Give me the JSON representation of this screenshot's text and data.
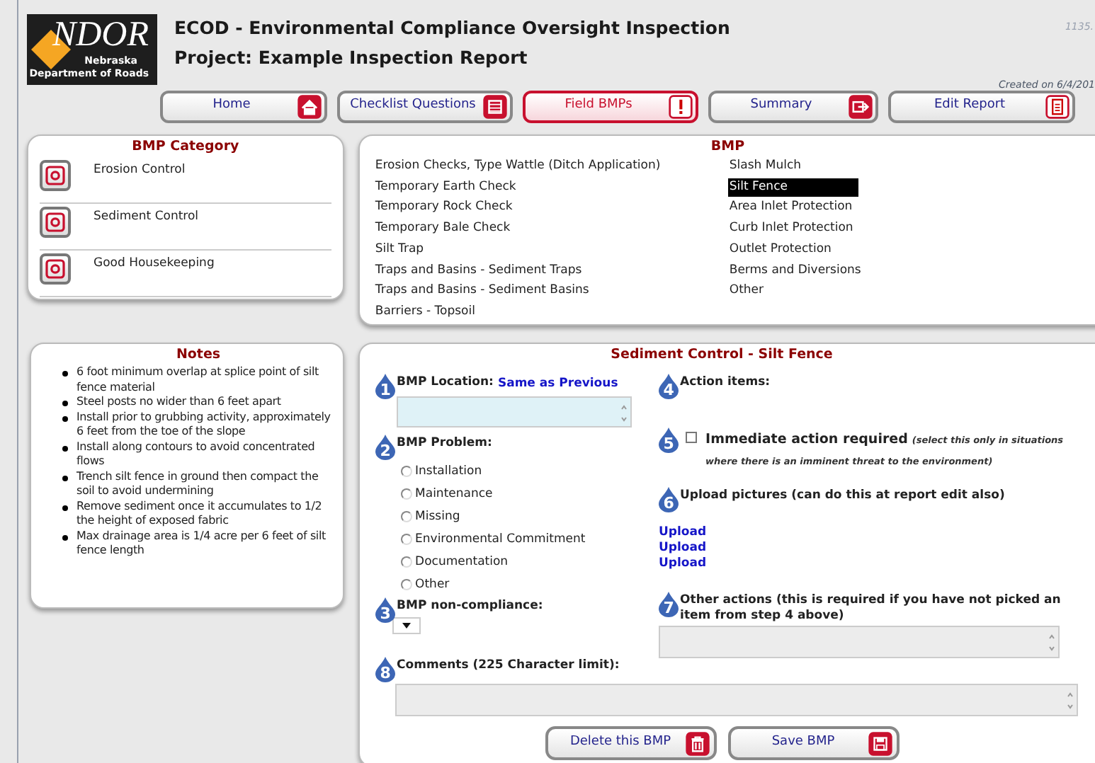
{
  "header": {
    "logo": {
      "wordmark": "NDOR",
      "line_1": "Nebraska",
      "line_2": "Department of Roads"
    },
    "title": "ECOD - Environmental Compliance Oversight Inspection",
    "subtitle": "Project: Example Inspection Report",
    "version": "1135.",
    "created": "Created on 6/4/201"
  },
  "nav": [
    {
      "label": "Home",
      "selected": false
    },
    {
      "label": "Checklist Questions",
      "selected": false
    },
    {
      "label": "Field BMPs",
      "selected": true
    },
    {
      "label": "Summary",
      "selected": false
    },
    {
      "label": "Edit Report",
      "selected": false
    }
  ],
  "category_panel": {
    "title": "BMP Category",
    "items": [
      "Erosion Control",
      "Sediment Control",
      "Good Housekeeping"
    ]
  },
  "bmp_panel": {
    "title": "BMP",
    "items": [
      {
        "label": "Erosion Checks, Type Wattle (Ditch Application)",
        "selected": false
      },
      {
        "label": "Temporary Earth Check",
        "selected": false
      },
      {
        "label": "Temporary Rock Check",
        "selected": false
      },
      {
        "label": "Temporary Bale Check",
        "selected": false
      },
      {
        "label": "Silt Trap",
        "selected": false
      },
      {
        "label": "Traps and Basins - Sediment Traps",
        "selected": false
      },
      {
        "label": "Traps and Basins - Sediment Basins",
        "selected": false
      },
      {
        "label": "Barriers - Topsoil",
        "selected": false
      },
      {
        "label": "Slash Mulch",
        "selected": false
      },
      {
        "label": "Silt Fence",
        "selected": true
      },
      {
        "label": "Area Inlet Protection",
        "selected": false
      },
      {
        "label": "Curb Inlet Protection",
        "selected": false
      },
      {
        "label": "Outlet Protection",
        "selected": false
      },
      {
        "label": "Berms and Diversions",
        "selected": false
      },
      {
        "label": "Other",
        "selected": false
      }
    ]
  },
  "notes": {
    "title": "Notes",
    "items": [
      "6 foot minimum overlap at splice point of silt fence material",
      "Steel posts no wider than 6 feet apart",
      "Install prior to grubbing activity, approximately 6 feet from the toe of the slope",
      "Install along contours to avoid concentrated flows",
      "Trench silt fence in ground then compact the soil to avoid undermining",
      "Remove sediment once it accumulates to 1/2 the height of exposed fabric",
      "Max drainage area is 1/4 acre per 6 feet of silt fence length"
    ]
  },
  "form": {
    "title": "Sediment Control - Silt Fence",
    "location": {
      "step": "1",
      "label": "BMP Location:",
      "link": "Same as Previous"
    },
    "problem": {
      "step": "2",
      "label": "BMP Problem:",
      "options": [
        {
          "label": "Installation",
          "selected": false
        },
        {
          "label": "Maintenance",
          "selected": false
        },
        {
          "label": "Missing",
          "selected": false
        },
        {
          "label": "Environmental Commitment",
          "selected": false
        },
        {
          "label": "Documentation",
          "selected": false
        },
        {
          "label": "Other",
          "selected": false
        }
      ]
    },
    "non_compliance": {
      "step": "3",
      "label": "BMP non-compliance:"
    },
    "action_items": {
      "step": "4",
      "label": "Action items:"
    },
    "immediate": {
      "step": "5",
      "label": "Immediate action required",
      "note": "(select this *only* in situations where there is an imminent threat to the environment)",
      "checked": false
    },
    "upload": {
      "step": "6",
      "label": "Upload pictures (can do this at report edit also)",
      "links": [
        "Upload",
        "Upload",
        "Upload"
      ]
    },
    "other_actions": {
      "step": "7",
      "label": "Other actions (this is required if you have not picked an item from step 4 above)"
    },
    "comments": {
      "step": "8",
      "label": "Comments (225 Character limit):"
    },
    "buttons": [
      "Delete this BMP",
      "Save BMP"
    ]
  }
}
